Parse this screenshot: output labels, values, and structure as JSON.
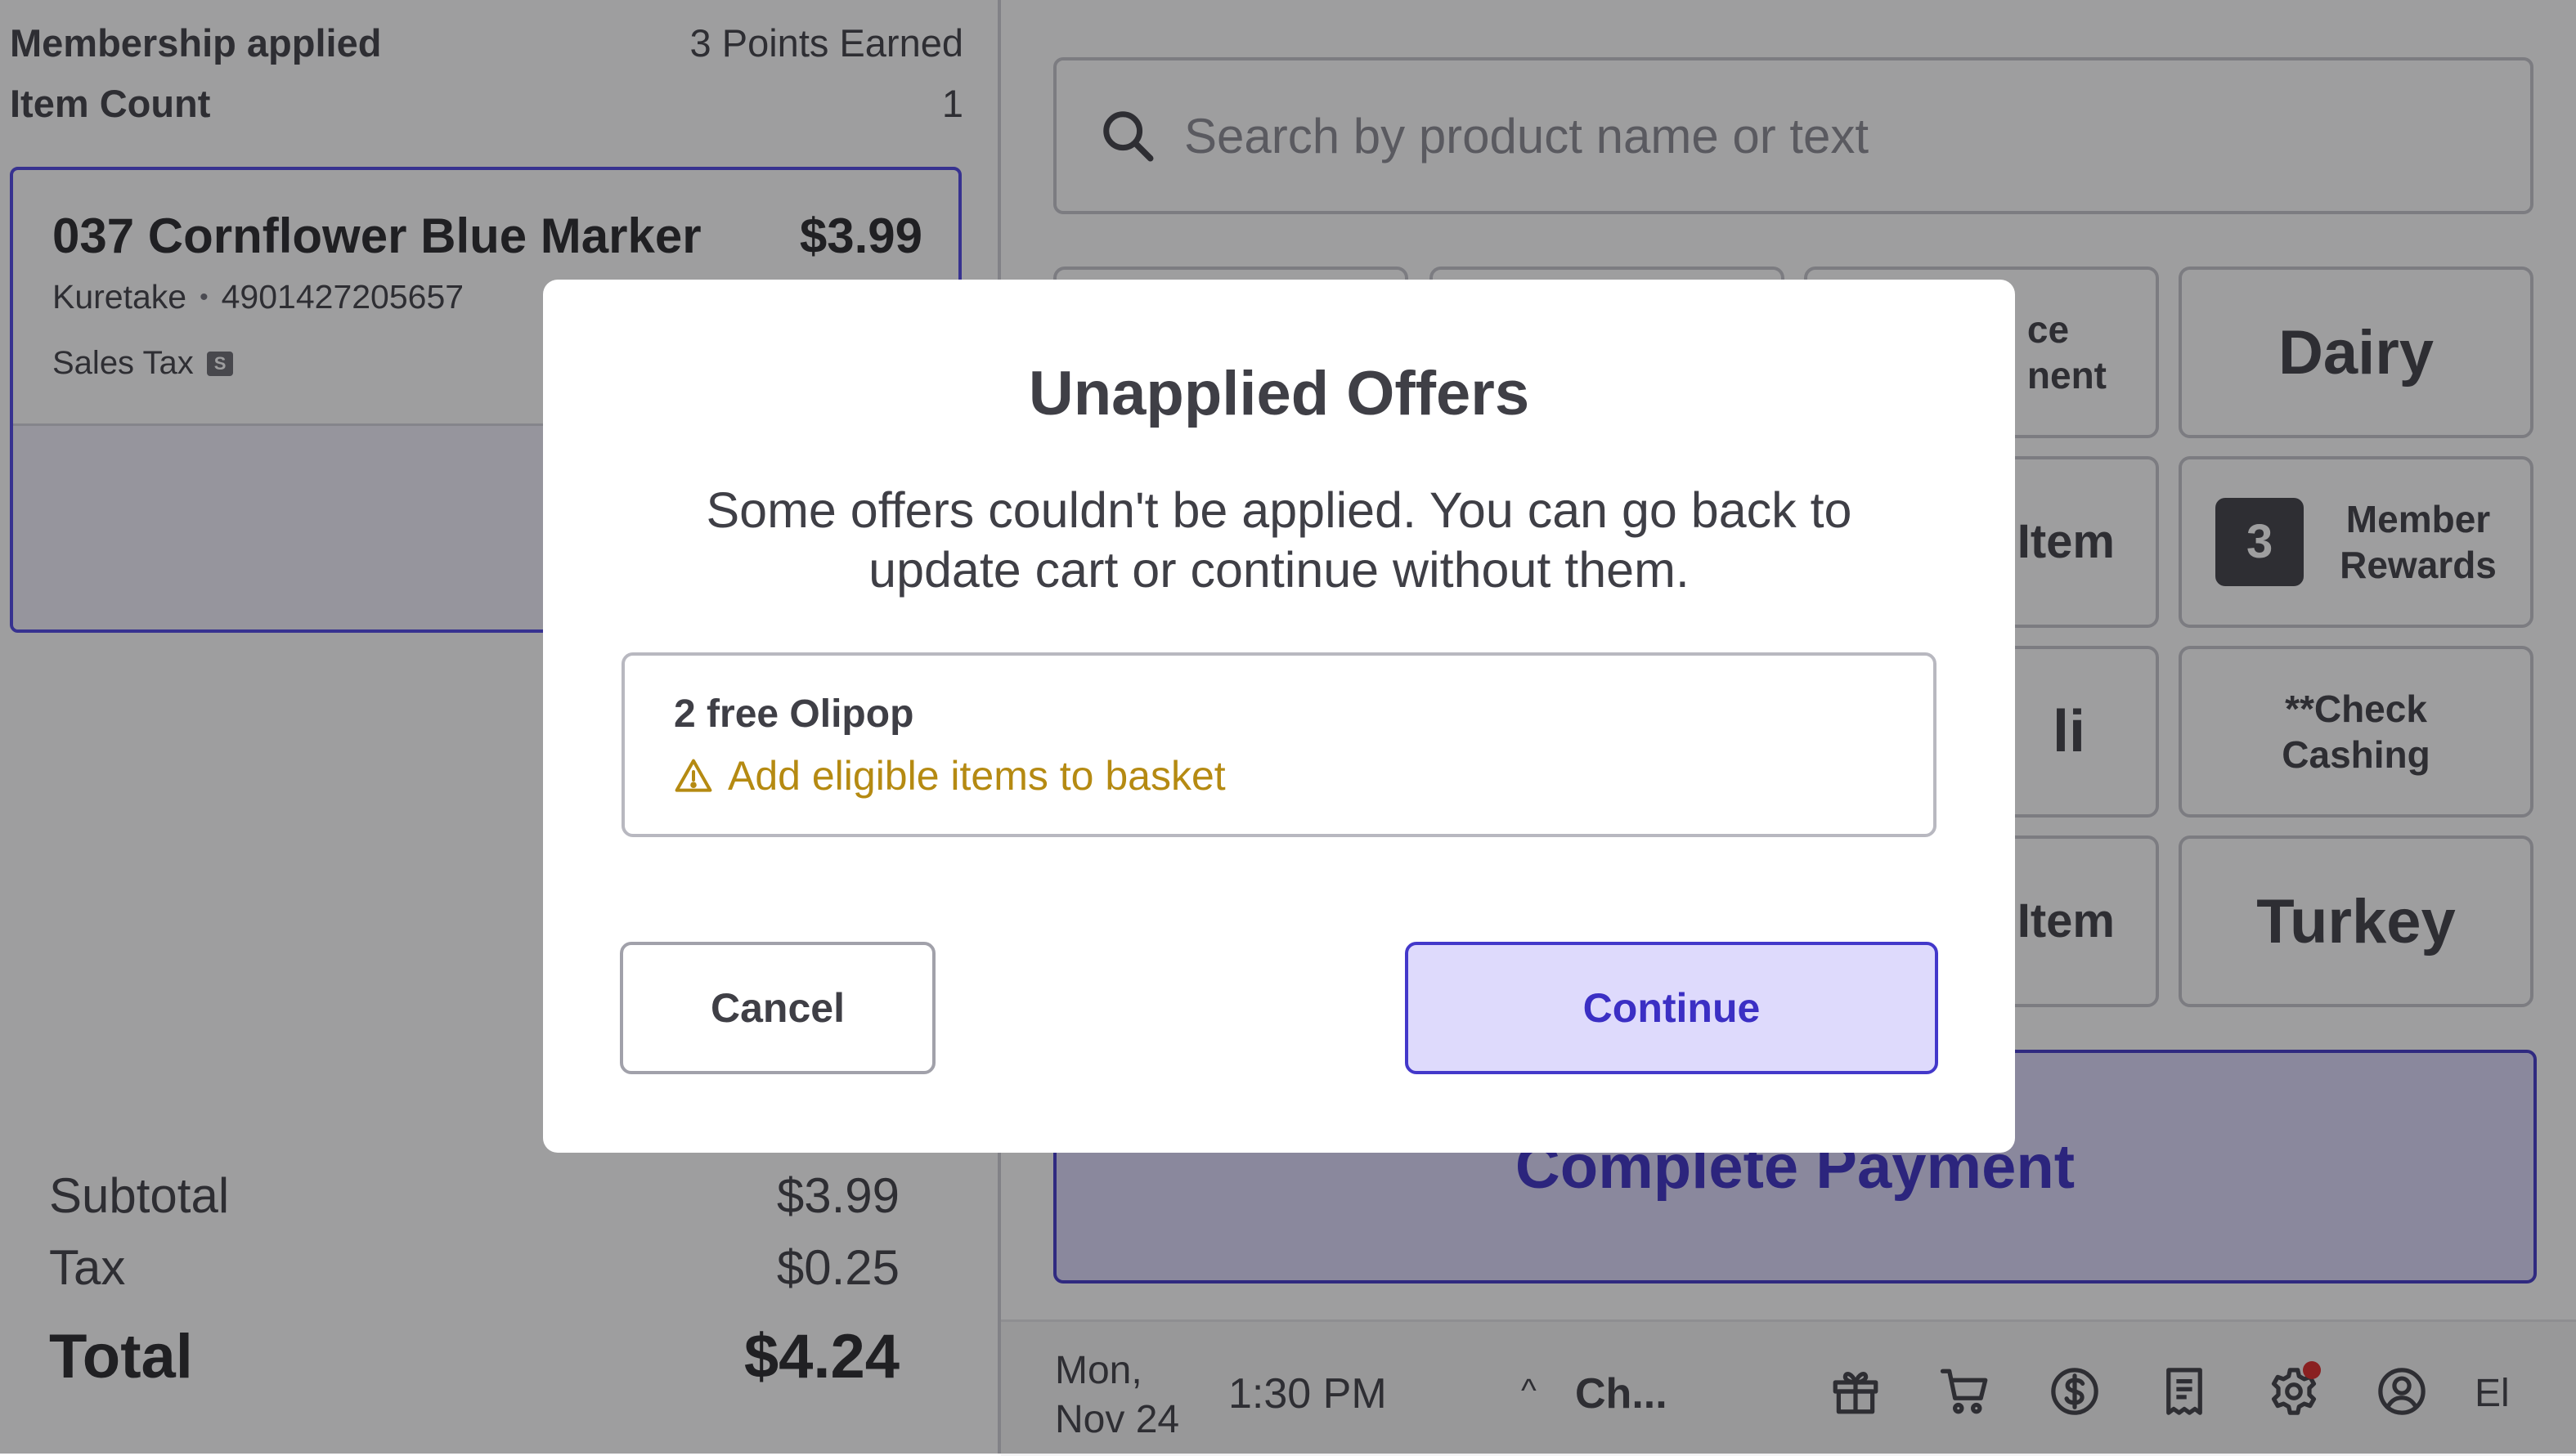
{
  "left_panel": {
    "membership_label": "Membership applied",
    "points_earned": "3 Points Earned",
    "item_count_label": "Item Count",
    "item_count_value": "1",
    "cart_item": {
      "name": "037 Cornflower Blue Marker",
      "price": "$3.99",
      "brand": "Kuretake",
      "separator": "•",
      "barcode": "4901427205657",
      "tax_label": "Sales Tax",
      "tax_badge": "S"
    },
    "summary": {
      "subtotal_label": "Subtotal",
      "subtotal_value": "$3.99",
      "tax_label": "Tax",
      "tax_value": "$0.25",
      "total_label": "Total",
      "total_value": "$4.24"
    }
  },
  "search": {
    "placeholder": "Search by product name or text",
    "icon": "search-icon"
  },
  "tiles": {
    "top_partial_1": "ce",
    "top_partial_2": "nent",
    "dairy": "Dairy",
    "row2_partial": "Item",
    "member_rewards_count": "3",
    "member_rewards_line1": "Member",
    "member_rewards_line2": "Rewards",
    "row3_partial": "li",
    "check_cashing_line1": "**Check",
    "check_cashing_line2": "Cashing",
    "row4_partial": "Item",
    "turkey": "Turkey"
  },
  "complete_payment_label": "Complete Payment",
  "statusbar": {
    "date_line1": "Mon,",
    "date_line2": "Nov 24",
    "time": "1:30 PM",
    "chevron": "^",
    "channel": "Ch...",
    "user_initials": "El",
    "icons": [
      "gift-icon",
      "cart-icon",
      "dollar-icon",
      "receipt-icon",
      "settings-icon",
      "user-icon"
    ]
  },
  "modal": {
    "title": "Unapplied Offers",
    "body": "Some offers couldn't be applied. You can go back to update cart or continue without them.",
    "offer_name": "2 free Olipop",
    "offer_warning": "Add eligible items to basket",
    "cancel_label": "Cancel",
    "continue_label": "Continue"
  },
  "colors": {
    "accent": "#4338ca",
    "accent_light": "#dedafc",
    "warning": "#b58a12",
    "overlay": "rgba(24,24,27,0.42)"
  }
}
